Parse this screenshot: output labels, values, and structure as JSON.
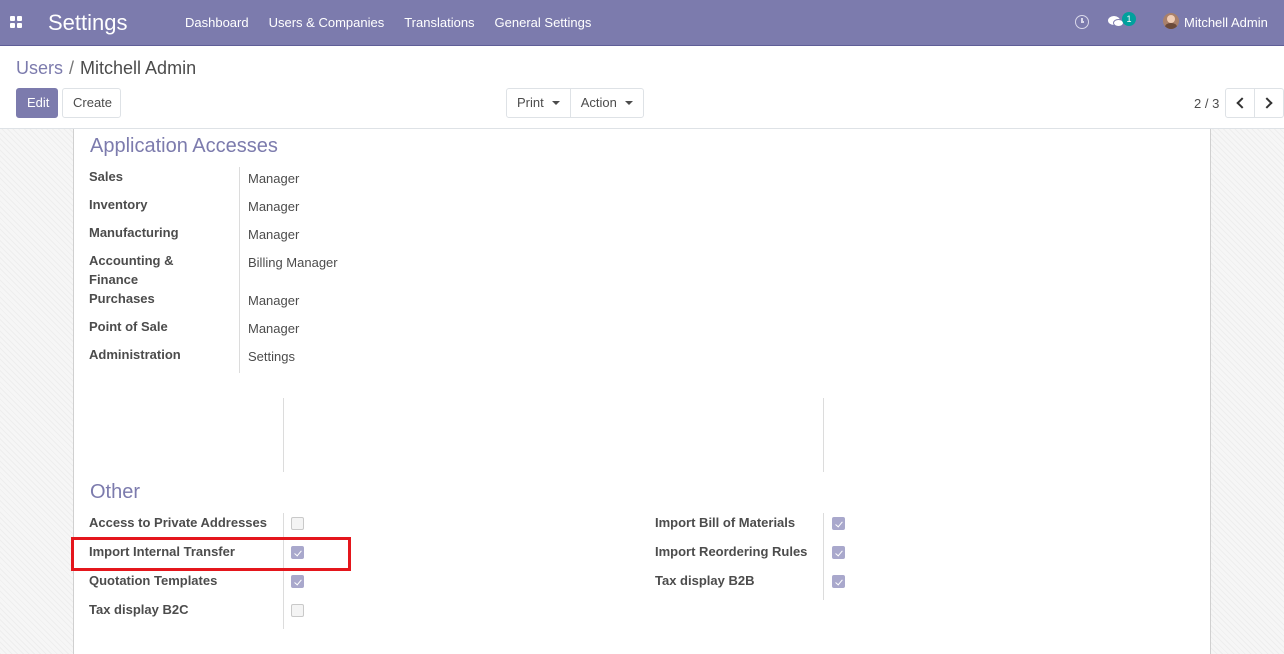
{
  "navbar": {
    "app_title": "Settings",
    "menu": [
      "Dashboard",
      "Users & Companies",
      "Translations",
      "General Settings"
    ],
    "message_count": "1",
    "user_name": "Mitchell Admin"
  },
  "breadcrumb": {
    "parent": "Users",
    "separator": "/",
    "current": "Mitchell Admin"
  },
  "toolbar": {
    "edit_label": "Edit",
    "create_label": "Create",
    "print_label": "Print",
    "action_label": "Action"
  },
  "pager": {
    "value": "2 / 3"
  },
  "application_accesses": {
    "title": "Application Accesses",
    "fields": [
      {
        "label": "Sales",
        "value": "Manager"
      },
      {
        "label": "Inventory",
        "value": "Manager"
      },
      {
        "label": "Manufacturing",
        "value": "Manager"
      },
      {
        "label": "Accounting & Finance",
        "value": "Billing Manager"
      },
      {
        "label": "Purchases",
        "value": "Manager"
      },
      {
        "label": "Point of Sale",
        "value": "Manager"
      },
      {
        "label": "Administration",
        "value": "Settings"
      }
    ]
  },
  "other": {
    "title": "Other",
    "left_fields": [
      {
        "label": "Access to Private Addresses",
        "checked": false
      },
      {
        "label": "Import Internal Transfer",
        "checked": true
      },
      {
        "label": "Quotation Templates",
        "checked": true
      },
      {
        "label": "Tax display B2C",
        "checked": false
      }
    ],
    "right_fields": [
      {
        "label": "Import Bill of Materials",
        "checked": true
      },
      {
        "label": "Import Reordering Rules",
        "checked": true
      },
      {
        "label": "Tax display B2B",
        "checked": true
      }
    ]
  },
  "colors": {
    "brand": "#7c7bad",
    "highlight": "#e4161c",
    "badge": "#00a09d"
  }
}
